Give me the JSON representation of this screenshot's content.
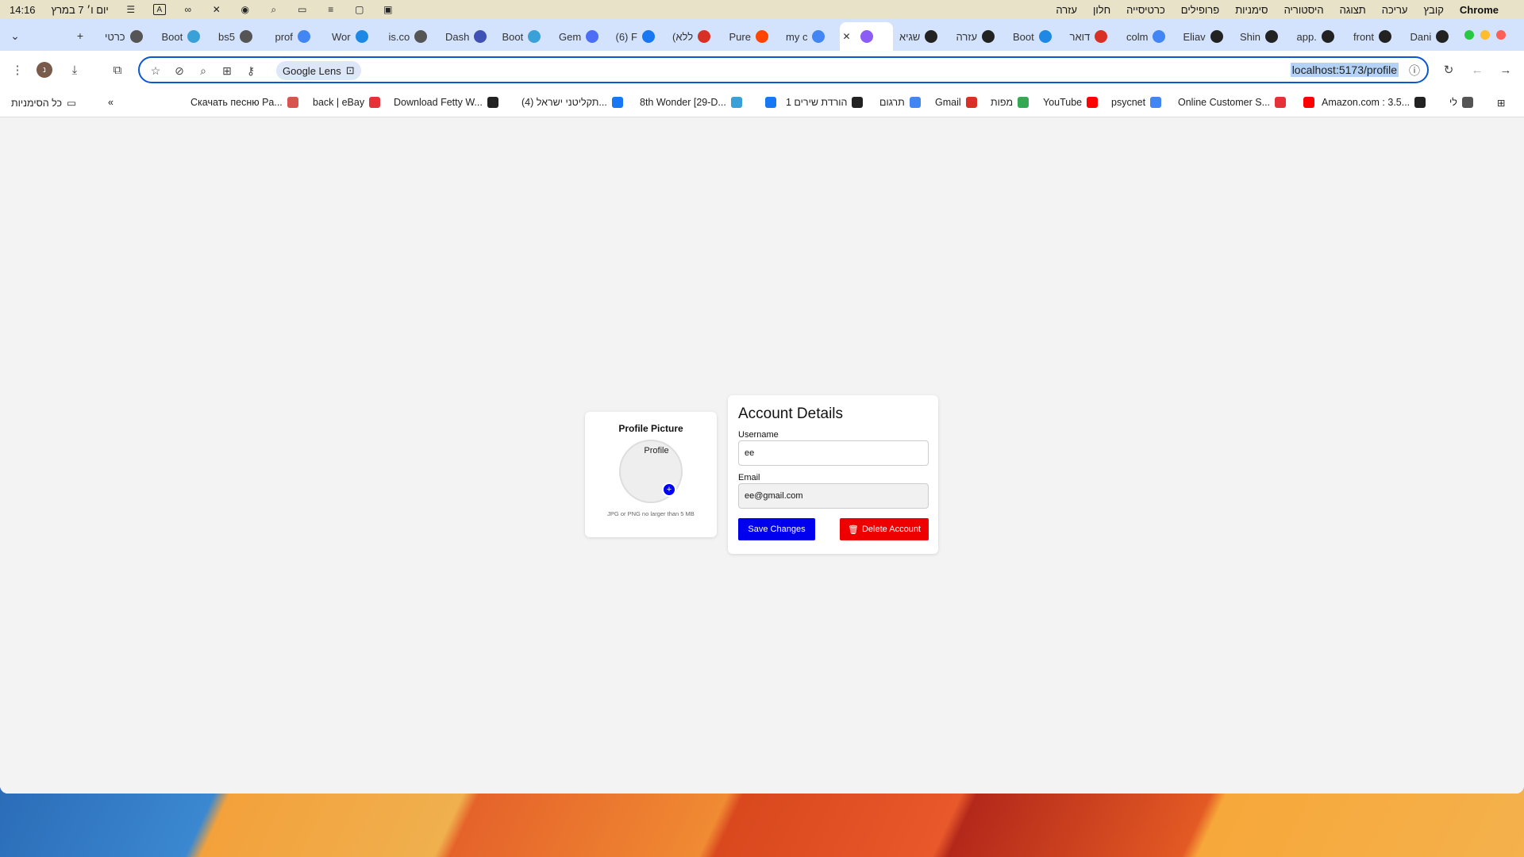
{
  "menubar": {
    "app_name": "Chrome",
    "items": [
      "קובץ",
      "עריכה",
      "תצוגה",
      "היסטוריה",
      "סימניות",
      "פרופילים",
      "כרטיסייה",
      "חלון",
      "עזרה"
    ],
    "clock": "14:16",
    "date": "יום ו׳ 7 במרץ"
  },
  "tabs": [
    {
      "title": "כרטי",
      "icon": "chrome-icon",
      "color": "#555"
    },
    {
      "title": "Boot",
      "icon": "bd-icon",
      "color": "#3aa0d8"
    },
    {
      "title": "bs5",
      "icon": "globe-icon",
      "color": "#555"
    },
    {
      "title": "prof",
      "icon": "google-icon",
      "color": "#4285f4"
    },
    {
      "title": "Wor",
      "icon": "vscode-icon",
      "color": "#1e88e5"
    },
    {
      "title": "is.co",
      "icon": "globe-icon",
      "color": "#555"
    },
    {
      "title": "Dash",
      "icon": "dashboard-icon",
      "color": "#3f51b5"
    },
    {
      "title": "Boot",
      "icon": "bd-icon",
      "color": "#3aa0d8"
    },
    {
      "title": "Gem",
      "icon": "gemini-icon",
      "color": "#4c6ef5"
    },
    {
      "title": "(6) F",
      "icon": "facebook-icon",
      "color": "#1877f2"
    },
    {
      "title": "(ללא",
      "icon": "gmail-icon",
      "color": "#d93025"
    },
    {
      "title": "Pure",
      "icon": "reddit-icon",
      "color": "#ff4500"
    },
    {
      "title": "my c",
      "icon": "google-icon",
      "color": "#4285f4"
    },
    {
      "title": "",
      "icon": "vite-icon",
      "color": "#8b5cf6",
      "active": true
    },
    {
      "title": "שגיא",
      "icon": "chatgpt-icon",
      "color": "#222"
    },
    {
      "title": "עזרה",
      "icon": "chatgpt-icon",
      "color": "#222"
    },
    {
      "title": "Boot",
      "icon": "msb-icon",
      "color": "#1e88e5"
    },
    {
      "title": "דואר",
      "icon": "gmail-icon",
      "color": "#d93025"
    },
    {
      "title": "colm",
      "icon": "docs-icon",
      "color": "#4285f4"
    },
    {
      "title": "Eliav",
      "icon": "github-icon",
      "color": "#222"
    },
    {
      "title": "Shin",
      "icon": "github-icon",
      "color": "#222"
    },
    {
      "title": "app.",
      "icon": "github-icon",
      "color": "#222"
    },
    {
      "title": "front",
      "icon": "github-icon",
      "color": "#222"
    },
    {
      "title": "Dani",
      "icon": "github-icon",
      "color": "#222"
    }
  ],
  "toolbar": {
    "lens_label": "Google Lens",
    "url": "localhost:5173/profile",
    "avatar_letter": "נ"
  },
  "bookmarks": {
    "all_label": "כל הסימניות",
    "items": [
      {
        "label": "Скачать песню Pa...",
        "color": "#d9534f"
      },
      {
        "label": "back | eBay",
        "color": "#e53238"
      },
      {
        "label": "Download Fetty W...",
        "color": "#222"
      },
      {
        "label": "(4) תקליטני ישראל...",
        "color": "#1877f2"
      },
      {
        "label": "8th Wonder [29-D...",
        "color": "#3aa0d8"
      },
      {
        "label": "",
        "color": "#1877f2"
      },
      {
        "label": "הורדת שירים 1",
        "color": "#222"
      },
      {
        "label": "תרגום",
        "color": "#4285f4"
      },
      {
        "label": "Gmail",
        "color": "#d93025"
      },
      {
        "label": "מפות",
        "color": "#34a853"
      },
      {
        "label": "YouTube",
        "color": "#ff0000"
      },
      {
        "label": "psycnet",
        "color": "#4285f4"
      },
      {
        "label": "Online Customer S...",
        "color": "#e53238"
      },
      {
        "label": "",
        "color": "#ff0000"
      },
      {
        "label": "Amazon.com : 3.5...",
        "color": "#222"
      },
      {
        "label": "לי",
        "color": "#555"
      }
    ]
  },
  "profile_card": {
    "title": "Profile Picture",
    "avatar_alt": "Profile",
    "hint": "JPG or PNG no larger than 5 MB"
  },
  "account": {
    "title": "Account Details",
    "username_label": "Username",
    "username_value": "ee",
    "email_label": "Email",
    "email_value": "ee@gmail.com",
    "save_label": "Save Changes",
    "delete_label": "Delete Account"
  },
  "colors": {
    "accent": "#0b57d0",
    "save": "#0000ee",
    "delete": "#ee0000"
  }
}
